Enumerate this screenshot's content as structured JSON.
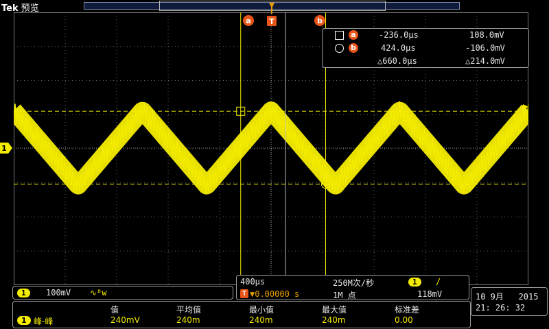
{
  "header": {
    "brand": "Tek",
    "mode": "预览"
  },
  "colors": {
    "trace": "#f4ec00",
    "cursor_badge": "#e8561a",
    "grid": "#6a6a6a",
    "panel_border": "#9a9a9a"
  },
  "markers": {
    "cursor_a": "a",
    "cursor_b": "b",
    "trigger": "T",
    "channel": "1",
    "trigger_level_icon": "triangle-left-icon"
  },
  "cursor_readout": {
    "a": {
      "time": "-236.0µs",
      "volt": "108.0mV"
    },
    "b": {
      "time": "424.0µs",
      "volt": "-106.0mV"
    },
    "delta": {
      "time": "△660.0µs",
      "volt": "△214.0mV"
    }
  },
  "channel_status": {
    "ch": "1",
    "scale": "100mV",
    "bw_icon": "∿ᴮw"
  },
  "horizontal": {
    "timebase": "400µs",
    "sample_rate": "250M次/秒",
    "trigger_position": "▼0.00000 s",
    "record_length": "1M 点",
    "trig_ch": "1",
    "trig_slope": "/",
    "trig_level": "118mV"
  },
  "clock": {
    "date": "10 9月   2015",
    "time": "21: 26: 32"
  },
  "measurement": {
    "headers": [
      "值",
      "平均值",
      "最小值",
      "最大值",
      "标准差"
    ],
    "ch": "1",
    "name": "峰-峰",
    "values": [
      "240mV",
      "240m",
      "240m",
      "240m",
      "0.00"
    ]
  },
  "waveform": {
    "type": "triangle",
    "peak_to_peak_mV": 240,
    "period_us": 1000,
    "volts_per_div_mV": 100,
    "time_per_div_us": 400
  }
}
